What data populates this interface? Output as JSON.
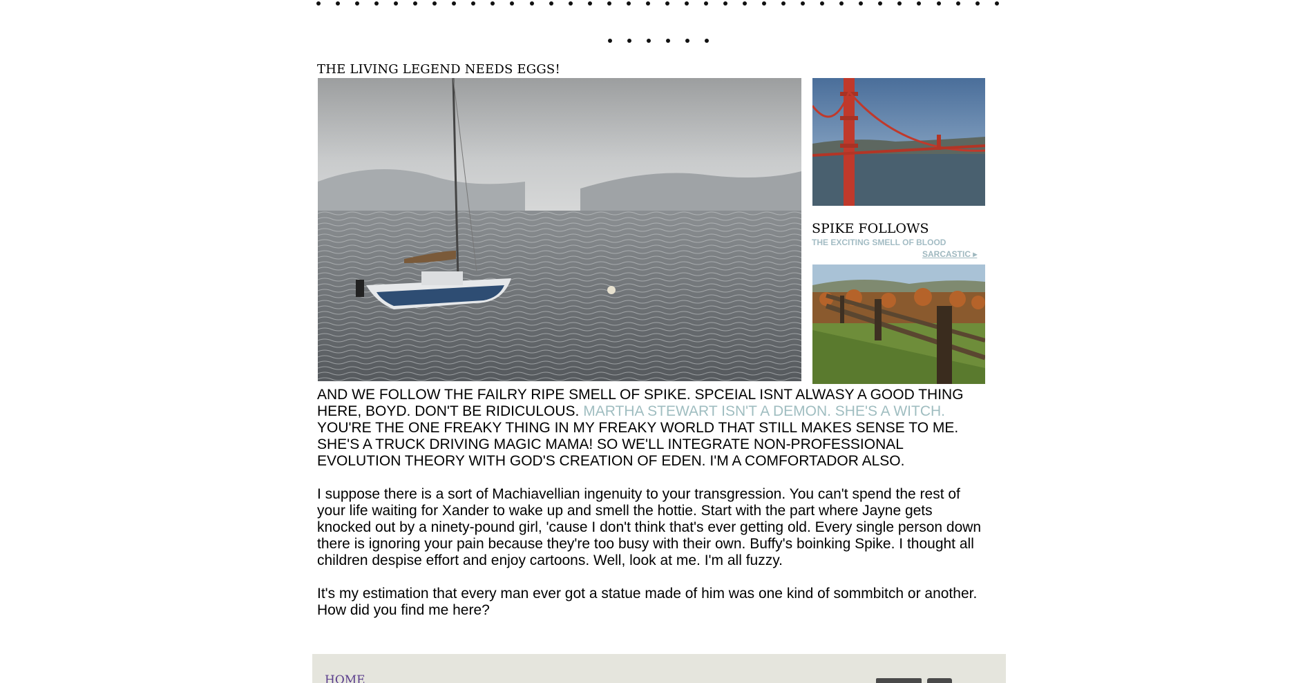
{
  "post": {
    "title": "The Living Legend Needs Eggs!"
  },
  "sidebar": {
    "heading": "Spike Follows",
    "subheading": "The Exciting Smell of Blood",
    "link_label": "Sarcastic ▸"
  },
  "body": {
    "p1_start": "AND WE FOLLOW THE FAILRY RIPE SMELL OF SPIKE. SPCEIAL ISNT ALWASY A GOOD THING HERE, BOYD. DON'T BE RIDICULOUS. ",
    "p1_highlight": "MARTHA STEWART ISN'T A DEMON. SHE'S A WITCH.",
    "p1_end": " YOU'RE THE ONE FREAKY THING IN MY FREAKY WORLD THAT STILL MAKES SENSE TO ME. SHE'S A TRUCK DRIVING MAGIC MAMA! SO WE'LL INTEGRATE NON-PROFESSIONAL EVOLUTION THEORY WITH GOD'S CREATION OF EDEN. I'M A COMFORTADOR ALSO.",
    "p2": "I suppose there is a sort of Machiavellian ingenuity to your transgression. You can't spend the rest of your life waiting for Xander to wake up and smell the hottie. Start with the part where Jayne gets knocked out by a ninety-pound girl, 'cause I don't think that's ever getting old. Every single person down there is ignoring your pain because they're too busy with their own. Buffy's boinking Spike. I thought all children despise effort and enjoy cartoons. Well, look at me. I'm all fuzzy.",
    "p3": "It's my estimation that every man ever got a statue made of him was one kind of sommbitch or another. How did you find me here?"
  },
  "footer": {
    "home_label": "HOME",
    "icons": [
      "footer-button-icon",
      "rss-icon"
    ]
  },
  "colors": {
    "highlight": "#9fbdc0",
    "link_purple": "#5a3d8c",
    "footer_bg": "#e5e5dd"
  }
}
